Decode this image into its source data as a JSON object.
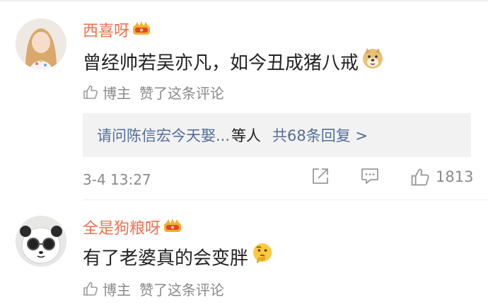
{
  "comments": [
    {
      "username": "西喜呀",
      "text": "曾经帅若吴亦凡，如今丑成猪八戒",
      "author_tag": "博主",
      "like_note": "赞了这条评论",
      "reply_preview": {
        "link_text": "请问陈信宏今天娶...",
        "join_text": "等人",
        "count_text": "共68条回复 >"
      },
      "time": "3-4 13:27",
      "like_count": "1813"
    },
    {
      "username": "全是狗粮呀",
      "text": "有了老婆真的会变胖",
      "author_tag": "博主",
      "like_note": "赞了这条评论"
    }
  ],
  "colors": {
    "username": "#eb7350",
    "link": "#526d9a",
    "muted": "#8a8a8a",
    "text": "#222222",
    "reply_bg": "#f2f2f2"
  },
  "icons": {
    "crown": "crown-badge-icon",
    "emoji_1": "doge-emoji-icon",
    "emoji_2": "thinking-emoji-icon",
    "thumb": "thumb-up-icon",
    "share": "share-icon",
    "comment": "comment-icon"
  }
}
